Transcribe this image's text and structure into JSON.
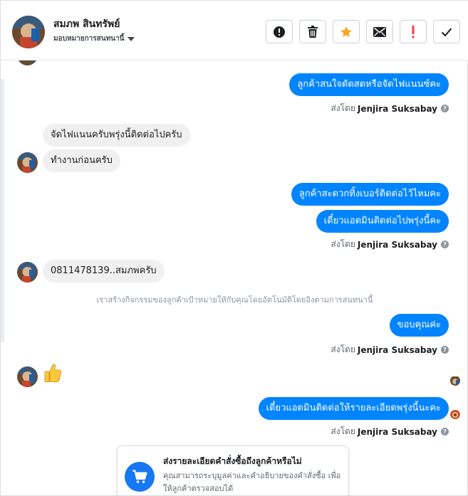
{
  "header": {
    "contact_name": "สมภพ สินทรัพย์",
    "assign_label": "มอบหมายการสนทนานี้"
  },
  "toolbar": {
    "buttons": [
      {
        "name": "mark-spam-button",
        "icon": "alert-circle-icon"
      },
      {
        "name": "delete-button",
        "icon": "trash-icon"
      },
      {
        "name": "star-button",
        "icon": "star-icon",
        "color": "#f5a623"
      },
      {
        "name": "mark-unread-button",
        "icon": "envelope-icon"
      },
      {
        "name": "follow-up-button",
        "icon": "exclamation-icon",
        "color": "#fa3e3e"
      },
      {
        "name": "mark-done-button",
        "icon": "check-icon"
      }
    ]
  },
  "messages": {
    "m1": "ลูกค้าสนใจดัดสดหรือจัดไฟแนนซ์คะ",
    "m2": "จัดไฟแนนครับพรุ่งนี้ติดต่อไปครับ",
    "m3": "ทำงานก่อนครับ",
    "m4": "ลูกค้าสะดวกทิ้งเบอร์ติดต่อไว้ไหมคะ",
    "m5": "เดี๋ยวแอดมินติดต่อไปพรุ่งนี้คะ",
    "m6": "0811478139..สมภพครับ",
    "m7": "ขอบคุณค่ะ",
    "m8": "👍",
    "m9": "เดี๋ยวแอดมินติดต่อให้รายละเอียดพรุ่งนี้นะคะ"
  },
  "sent_by": {
    "prefix": "ส่งโดย",
    "agent": "Jenjira Suksabay"
  },
  "system_note": "เราสร้างกิจกรรมของลูกค้าเป้าหมายให้กับคุณโดยอัตโนมัติโดยอิงตามการสนทนานี้",
  "order_card": {
    "icon": "shopping-cart-icon",
    "title": "ส่งรายละเอียดคำสั่งซื้อถึงลูกค้าหรือไม่",
    "description": "คุณสามารถระบุมูลค่าและคำอธิบายของคำสั่งซื้อ เพื่อให้ลูกค้าตรวจสอบได้"
  },
  "colors": {
    "outgoing_bubble": "#0084ff",
    "incoming_bubble": "#f1f0f0",
    "accent": "#1877f2"
  }
}
